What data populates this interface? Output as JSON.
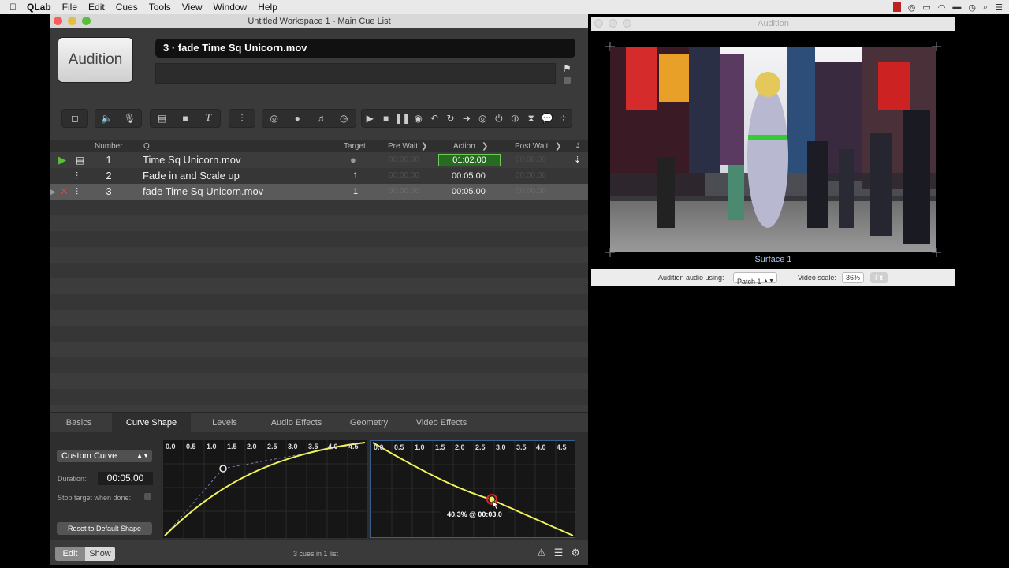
{
  "menubar": {
    "apple": "",
    "app": "QLab",
    "items": [
      "File",
      "Edit",
      "Cues",
      "Tools",
      "View",
      "Window",
      "Help"
    ]
  },
  "main": {
    "title": "Untitled Workspace 1 - Main Cue List",
    "audition_label": "Audition",
    "cue_name": "3 · fade Time Sq Unicorn.mov"
  },
  "columns": {
    "number": "Number",
    "q": "Q",
    "target": "Target",
    "prewait": "Pre Wait",
    "action": "Action",
    "postwait": "Post Wait"
  },
  "cues": [
    {
      "number": "1",
      "name": "Time Sq Unicorn.mov",
      "target": "",
      "prewait": "00:00.00",
      "action": "01:02.00",
      "postwait": "00:00.00"
    },
    {
      "number": "2",
      "name": "Fade in and Scale up",
      "target": "1",
      "prewait": "00:00.00",
      "action": "00:05.00",
      "postwait": "00:00.00"
    },
    {
      "number": "3",
      "name": "fade Time Sq Unicorn.mov",
      "target": "1",
      "prewait": "00:00.00",
      "action": "00:05.00",
      "postwait": "00:00.00"
    }
  ],
  "inspector": {
    "tabs": [
      "Basics",
      "Curve Shape",
      "Levels",
      "Audio Effects",
      "Geometry",
      "Video Effects"
    ],
    "active_tab": "Curve Shape",
    "curve_type": "Custom Curve",
    "duration_label": "Duration:",
    "duration": "00:05.00",
    "stop_label": "Stop target when done:",
    "reset_label": "Reset to Default Shape",
    "ticks": [
      "0.0",
      "0.5",
      "1.0",
      "1.5",
      "2.0",
      "2.5",
      "3.0",
      "3.5",
      "4.0",
      "4.5"
    ],
    "tooltip": "40.3% @ 00:03.0"
  },
  "status": {
    "edit": "Edit",
    "show": "Show",
    "text": "3 cues in 1 list"
  },
  "audition": {
    "title": "Audition",
    "surface": "Surface 1",
    "audio_label": "Audition audio using:",
    "patch": "Patch 1",
    "scale_label": "Video scale:",
    "scale": "36%",
    "fit": "Fit"
  },
  "colors": {
    "go_green": "#57c038",
    "selected_action": "#276a21",
    "curve": "#f2f25a",
    "accent_blue": "#3a5f8a"
  }
}
